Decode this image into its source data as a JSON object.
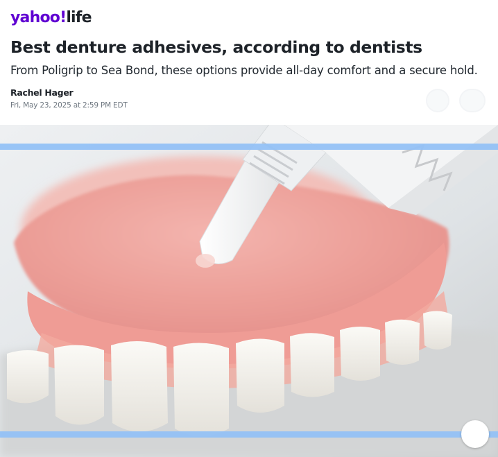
{
  "brand": {
    "logo_main": "yahoo!",
    "logo_section": "life"
  },
  "article": {
    "headline": "Best denture adhesives, according to dentists",
    "subhead": "From Poligrip to Sea Bond, these options provide all-day comfort and a secure hold.",
    "author": "Rachel Hager",
    "date": "Fri, May 23, 2025 at 2:59 PM EDT"
  },
  "hero_image": {
    "description_icon": "denture-adhesive-photo"
  },
  "colors": {
    "brand": "#6001d2",
    "text": "#1d2228",
    "highlight": "#93c1f6"
  }
}
